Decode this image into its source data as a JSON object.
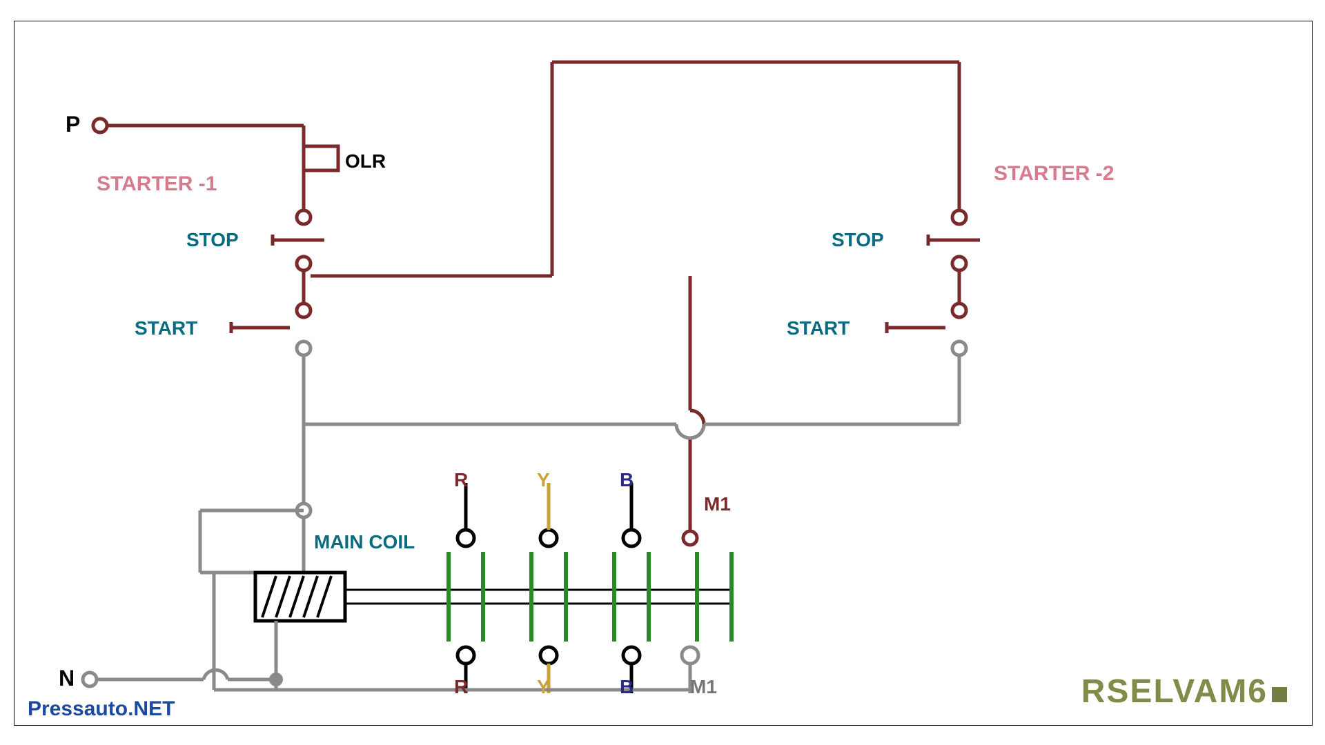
{
  "labels": {
    "P": "P",
    "N": "N",
    "OLR": "OLR",
    "STOP": "STOP",
    "START": "START",
    "starter1": "STARTER -1",
    "starter2": "STARTER -2",
    "mainCoil": "MAIN COIL",
    "R": "R",
    "Y": "Y",
    "B": "B",
    "M1": "M1"
  },
  "watermark": "RSELVAM6",
  "source": "Pressauto.NET",
  "colors": {
    "maroon": "#7a2a2a",
    "gray": "#8a8a8a",
    "green": "#2a8a2a",
    "gold": "#c9a23a",
    "navy": "#2a2a80",
    "teal": "#0a6b80",
    "pink": "#d67a8e"
  },
  "diagram": {
    "type": "electrical-control-circuit",
    "description": "Two-station start/stop motor starter control with main coil contactor M1",
    "components": [
      {
        "id": "P",
        "type": "supply-terminal",
        "label": "P"
      },
      {
        "id": "N",
        "type": "neutral-terminal",
        "label": "N"
      },
      {
        "id": "OLR",
        "type": "overload-relay",
        "label": "OLR"
      },
      {
        "id": "STOP1",
        "type": "nc-pushbutton",
        "label": "STOP",
        "station": "Starter-1"
      },
      {
        "id": "START1",
        "type": "no-pushbutton",
        "label": "START",
        "station": "Starter-1"
      },
      {
        "id": "STOP2",
        "type": "nc-pushbutton",
        "label": "STOP",
        "station": "Starter-2"
      },
      {
        "id": "START2",
        "type": "no-pushbutton",
        "label": "START",
        "station": "Starter-2"
      },
      {
        "id": "MAIN_COIL",
        "type": "contactor-coil",
        "label": "MAIN COIL"
      },
      {
        "id": "M1",
        "type": "contactor-aux",
        "label": "M1"
      },
      {
        "id": "R_PH",
        "type": "phase-terminal",
        "label": "R"
      },
      {
        "id": "Y_PH",
        "type": "phase-terminal",
        "label": "Y"
      },
      {
        "id": "B_PH",
        "type": "phase-terminal",
        "label": "B"
      }
    ]
  }
}
